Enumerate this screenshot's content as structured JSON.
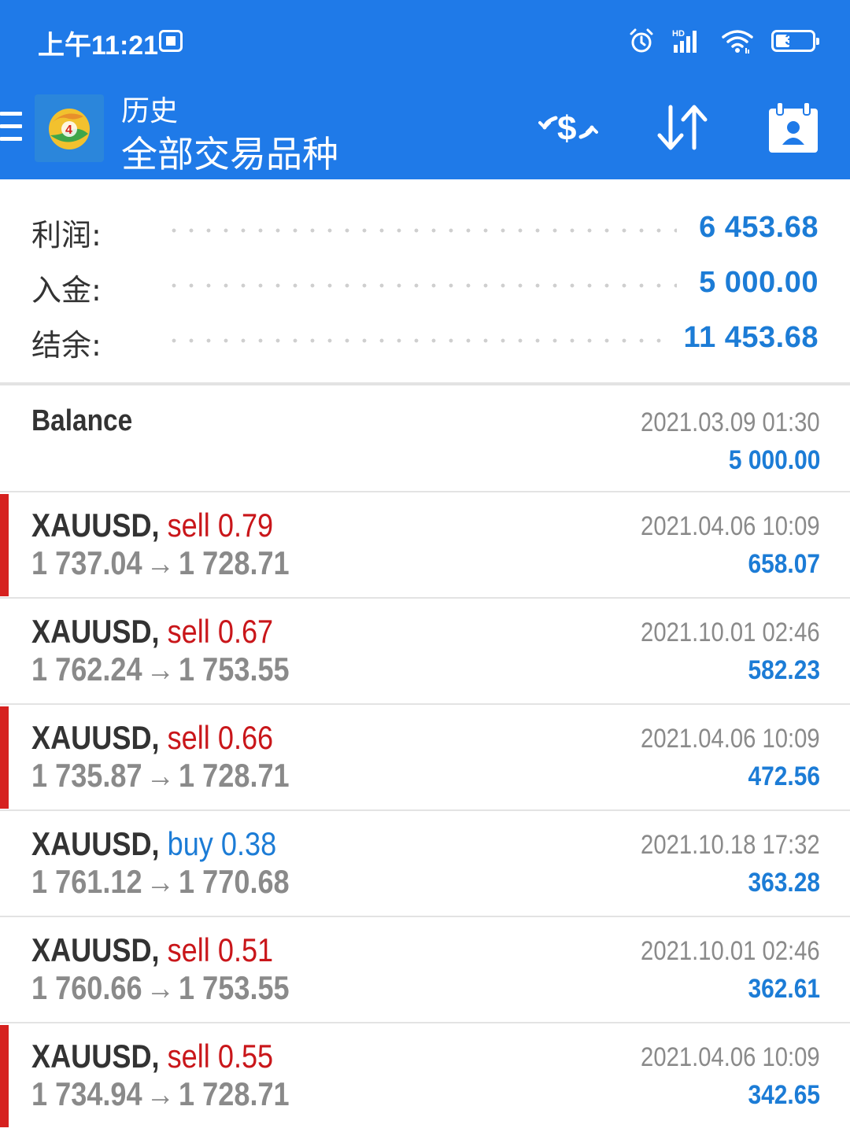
{
  "status_bar": {
    "time": "上午11:21",
    "network_label": "HD",
    "battery": "39",
    "battery_level": 0.39
  },
  "toolbar": {
    "title": "历史",
    "subtitle": "全部交易品种",
    "buttons": [
      {
        "icon": "currency-exchange-icon"
      },
      {
        "icon": "sort-arrows-icon"
      },
      {
        "icon": "calendar-person-icon"
      }
    ]
  },
  "summary": {
    "profit_label": "利润:",
    "profit_value": "6 453.68",
    "deposit_label": "入金:",
    "deposit_value": "5 000.00",
    "balance_label": "结余:",
    "balance_value": "11 453.68"
  },
  "balance_entry": {
    "title": "Balance",
    "date": "2021.03.09 01:30",
    "amount": "5 000.00"
  },
  "trades": [
    {
      "symbol": "XAUUSD,",
      "side": "sell",
      "lot": "0.79",
      "open": "1 737.04",
      "close": "1 728.71",
      "date": "2021.04.06 10:09",
      "profit": "658.07",
      "flag": true
    },
    {
      "symbol": "XAUUSD,",
      "side": "sell",
      "lot": "0.67",
      "open": "1 762.24",
      "close": "1 753.55",
      "date": "2021.10.01 02:46",
      "profit": "582.23",
      "flag": false
    },
    {
      "symbol": "XAUUSD,",
      "side": "sell",
      "lot": "0.66",
      "open": "1 735.87",
      "close": "1 728.71",
      "date": "2021.04.06 10:09",
      "profit": "472.56",
      "flag": true
    },
    {
      "symbol": "XAUUSD,",
      "side": "buy",
      "lot": "0.38",
      "open": "1 761.12",
      "close": "1 770.68",
      "date": "2021.10.18 17:32",
      "profit": "363.28",
      "flag": false
    },
    {
      "symbol": "XAUUSD,",
      "side": "sell",
      "lot": "0.51",
      "open": "1 760.66",
      "close": "1 753.55",
      "date": "2021.10.01 02:46",
      "profit": "362.61",
      "flag": false
    },
    {
      "symbol": "XAUUSD,",
      "side": "sell",
      "lot": "0.55",
      "open": "1 734.94",
      "close": "1 728.71",
      "date": "2021.04.06 10:09",
      "profit": "342.65",
      "flag": true
    }
  ],
  "colors": {
    "header_bg": "#1f7ae8",
    "sell": "#c9161a",
    "buy": "#1c7cd6",
    "value_blue": "#1c7cd6",
    "flag_red": "#d6211f"
  }
}
